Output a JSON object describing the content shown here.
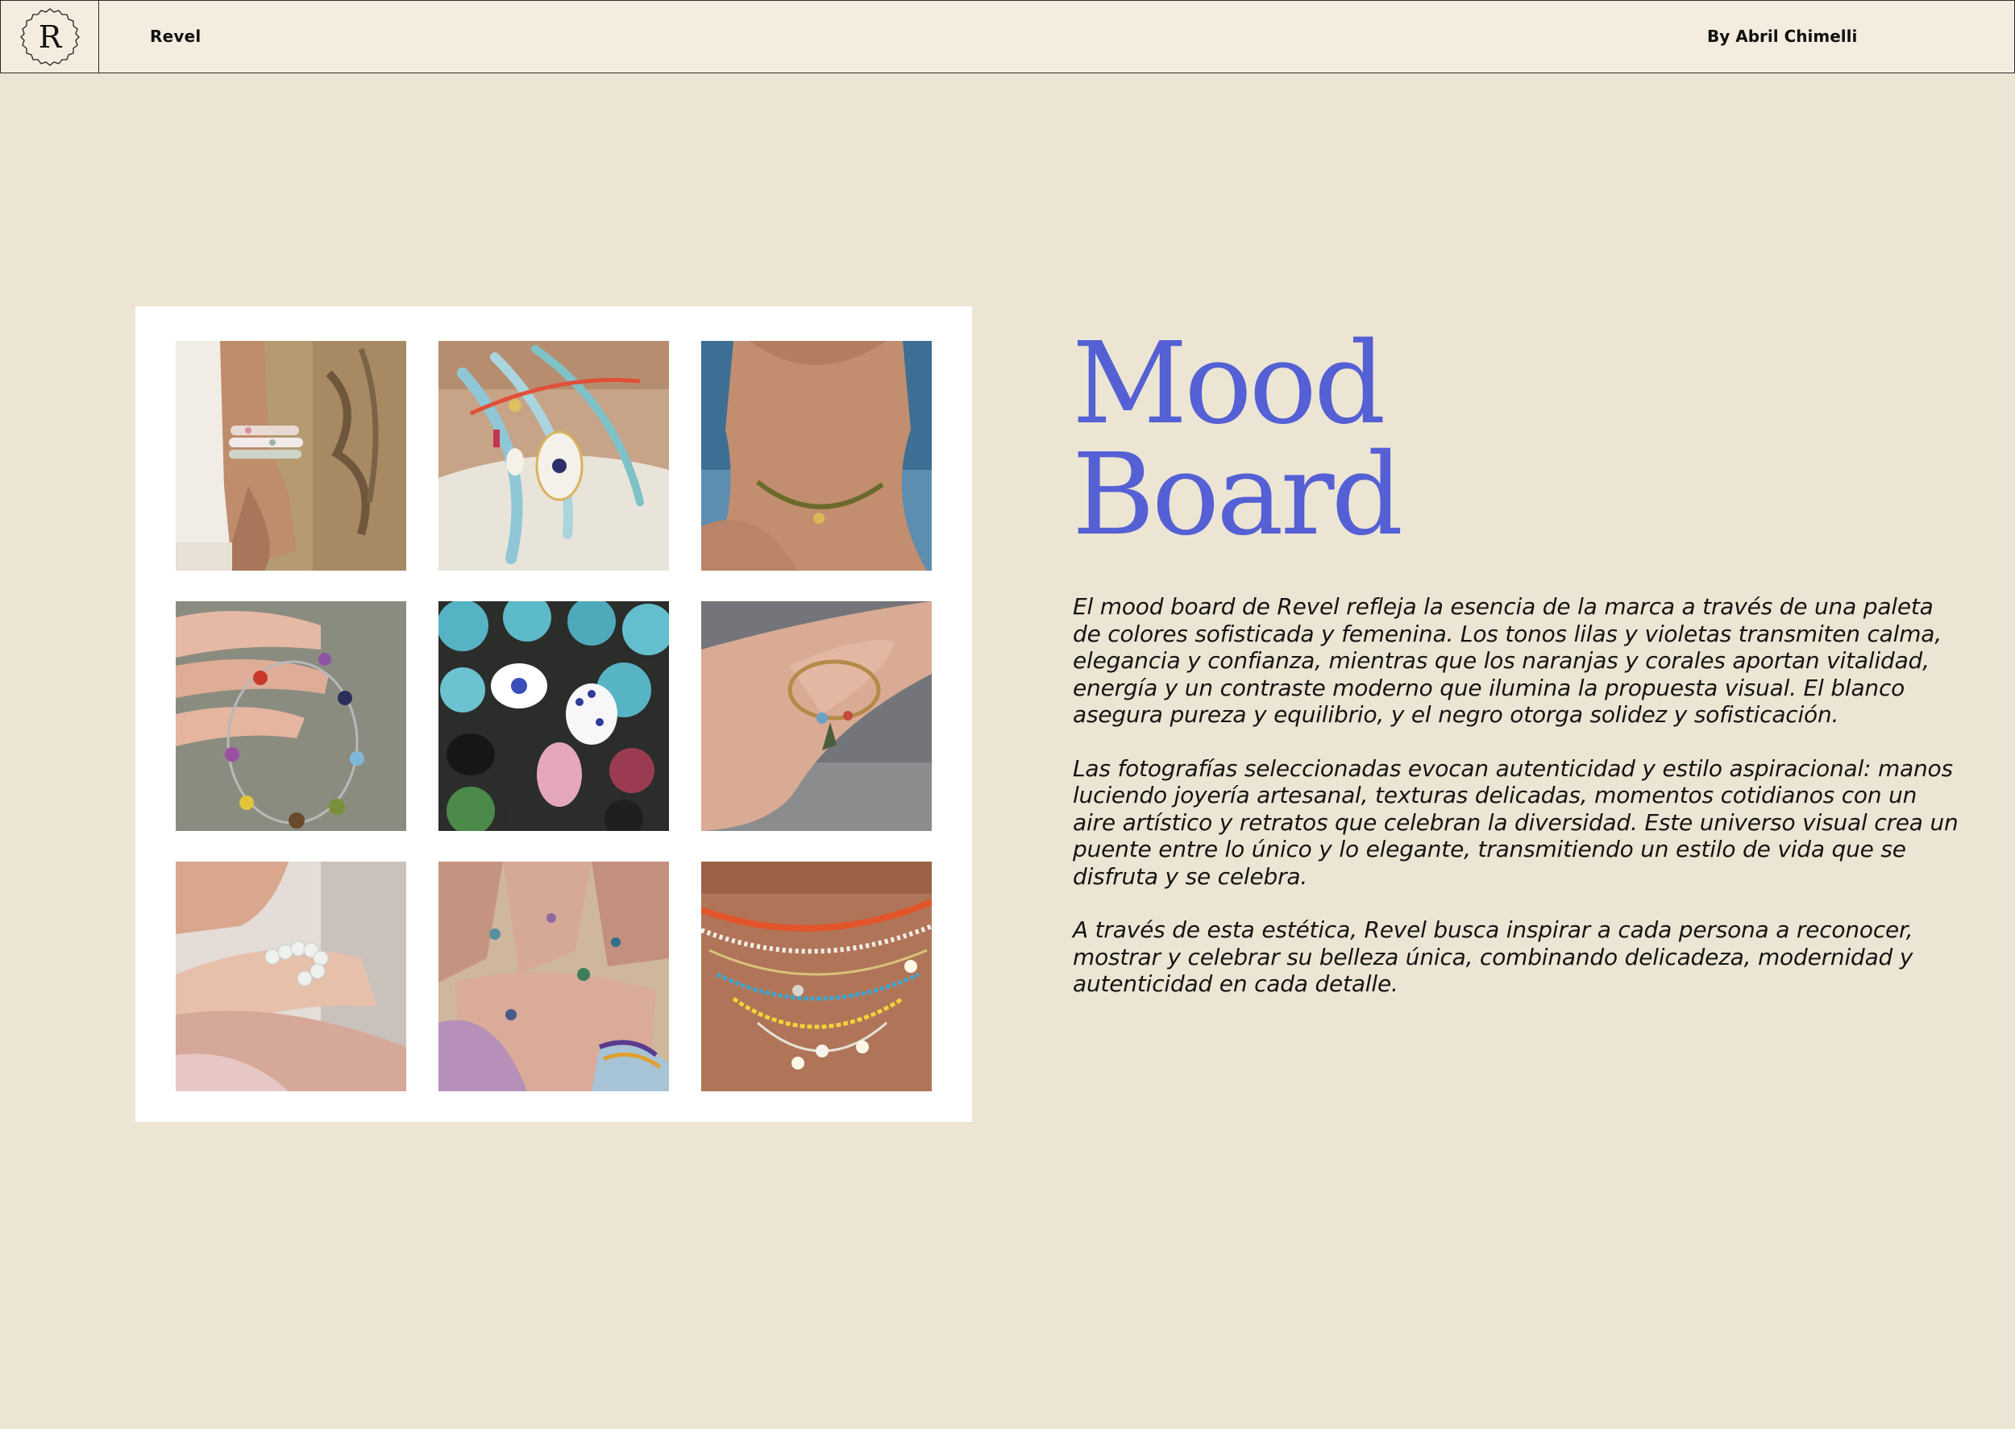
{
  "header": {
    "logo_letter": "R",
    "brand": "Revel",
    "author": "By Abril Chimelli"
  },
  "gallery": {
    "photos": [
      {
        "subject": "wrist with white beaded bracelets",
        "palette": [
          "#b89a6e",
          "#6b5740",
          "#efe8df"
        ]
      },
      {
        "subject": "hand with turquoise bead necklaces and evil-eye pendant",
        "palette": [
          "#caa384",
          "#8fc3d1",
          "#e9e5d8"
        ]
      },
      {
        "subject": "neck with gold bead choker",
        "palette": [
          "#3d6b8c",
          "#c18e6e",
          "#6e6a2a"
        ]
      },
      {
        "subject": "fingers holding colorful gemstone bracelet",
        "palette": [
          "#8c8d7f",
          "#e3b39f",
          "#c93a28"
        ]
      },
      {
        "subject": "turquoise and evil-eye beads close-up",
        "palette": [
          "#4fb3c4",
          "#1c1c1c",
          "#ffffff"
        ]
      },
      {
        "subject": "wrist with thin beaded bracelet and charm",
        "palette": [
          "#74757a",
          "#d5a690",
          "#caa45a"
        ]
      },
      {
        "subject": "wrist with white bead bracelet and pink sequins",
        "palette": [
          "#e6d3cf",
          "#d9b6a4",
          "#cfa7a0"
        ]
      },
      {
        "subject": "many hands with rings and beaded bracelets",
        "palette": [
          "#c7a18d",
          "#a6c0d2",
          "#7d5a8a"
        ]
      },
      {
        "subject": "layered colorful seed bead necklaces",
        "palette": [
          "#b07358",
          "#e2542a",
          "#f1d43a"
        ]
      }
    ]
  },
  "title": {
    "line1": "Mood",
    "line2": "Board",
    "color": "#5460d4"
  },
  "paragraphs": [
    "El mood board de Revel refleja la esencia de la marca a través de una paleta de colores sofisticada y femenina. Los tonos lilas y violetas transmiten calma, elegancia y confianza, mientras que los naranjas y corales aportan vitalidad, energía y un contraste moderno que ilumina la propuesta visual. El blanco asegura pureza y equilibrio, y el negro otorga solidez y sofisticación.",
    "Las fotografías seleccionadas evocan autenticidad y estilo aspiracional: manos luciendo joyería artesanal, texturas delicadas, momentos cotidianos con un aire artístico y retratos que celebran la diversidad. Este universo visual crea un puente entre lo único y lo elegante, transmitiendo un estilo de vida que se disfruta y se celebra.",
    "A través de esta estética, Revel busca inspirar a cada persona a reconocer, mostrar y celebrar su belleza única, combinando delicadeza, modernidad y autenticidad en cada detalle."
  ]
}
